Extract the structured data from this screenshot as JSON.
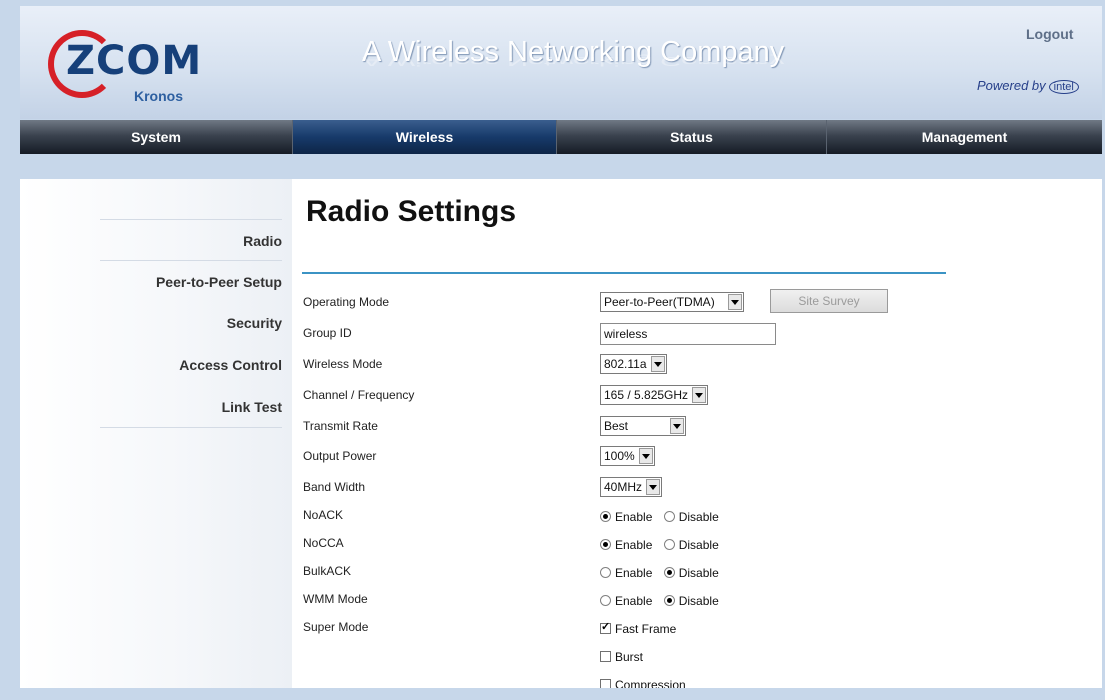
{
  "header": {
    "logo_text": "ZCOM",
    "product": "Kronos",
    "tagline": "A Wireless Networking Company",
    "logout": "Logout",
    "powered_by": "Powered by",
    "intel": "intel"
  },
  "nav": [
    "System",
    "Wireless",
    "Status",
    "Management"
  ],
  "nav_active": "Wireless",
  "sidebar": [
    "Radio",
    "Peer-to-Peer Setup",
    "Security",
    "Access Control",
    "Link Test"
  ],
  "page": {
    "title": "Radio Settings"
  },
  "form": {
    "operating_mode": {
      "label": "Operating Mode",
      "value": "Peer-to-Peer(TDMA)",
      "button": "Site Survey"
    },
    "group_id": {
      "label": "Group ID",
      "value": "wireless"
    },
    "wireless_mode": {
      "label": "Wireless Mode",
      "value": "802.11a"
    },
    "channel": {
      "label": "Channel / Frequency",
      "value": "165 / 5.825GHz"
    },
    "transmit_rate": {
      "label": "Transmit Rate",
      "value": "Best"
    },
    "output_power": {
      "label": "Output Power",
      "value": "100%"
    },
    "band_width": {
      "label": "Band Width",
      "value": "40MHz"
    },
    "noack": {
      "label": "NoACK",
      "enable": "Enable",
      "disable": "Disable",
      "selected": "Enable"
    },
    "nocca": {
      "label": "NoCCA",
      "enable": "Enable",
      "disable": "Disable",
      "selected": "Enable"
    },
    "bulkack": {
      "label": "BulkACK",
      "enable": "Enable",
      "disable": "Disable",
      "selected": "Disable"
    },
    "wmm": {
      "label": "WMM Mode",
      "enable": "Enable",
      "disable": "Disable",
      "selected": "Disable"
    },
    "super_mode": {
      "label": "Super Mode",
      "options": [
        {
          "label": "Fast Frame",
          "checked": true
        },
        {
          "label": "Burst",
          "checked": false
        },
        {
          "label": "Compression",
          "checked": false
        }
      ]
    }
  },
  "colors": {
    "accent_line": "#3b93c4",
    "nav_active": "#173a6a",
    "logo_red": "#d62027",
    "logo_blue": "#16407a"
  }
}
